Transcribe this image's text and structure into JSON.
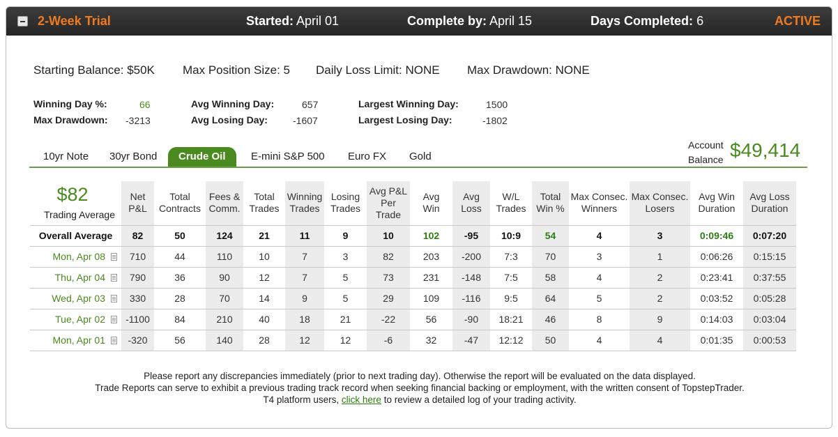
{
  "header": {
    "trial_name": "2-Week Trial",
    "started_label": "Started:",
    "started_value": "April 01",
    "complete_label": "Complete by:",
    "complete_value": "April 15",
    "days_label": "Days Completed:",
    "days_value": "6",
    "status": "ACTIVE",
    "collapse_icon": "minus-icon"
  },
  "rules": {
    "starting_balance": "Starting Balance: $50K",
    "max_position": "Max Position Size: 5",
    "daily_loss": "Daily Loss Limit: NONE",
    "max_drawdown": "Max Drawdown: NONE"
  },
  "kpis": {
    "winning_day_pct_label": "Winning Day %:",
    "winning_day_pct": "66",
    "max_drawdown_label": "Max Drawdown:",
    "max_drawdown": "-3213",
    "avg_winning_day_label": "Avg Winning Day:",
    "avg_winning_day": "657",
    "avg_losing_day_label": "Avg Losing Day:",
    "avg_losing_day": "-1607",
    "largest_winning_day_label": "Largest Winning Day:",
    "largest_winning_day": "1500",
    "largest_losing_day_label": "Largest Losing Day:",
    "largest_losing_day": "-1802"
  },
  "tabs": [
    "10yr Note",
    "30yr Bond",
    "Crude Oil",
    "E-mini S&P 500",
    "Euro FX",
    "Gold"
  ],
  "active_tab": "Crude Oil",
  "account": {
    "label_line1": "Account",
    "label_line2": "Balance",
    "value": "$49,414"
  },
  "trading_average": {
    "value": "$82",
    "label": "Trading Average"
  },
  "table": {
    "headers": [
      [
        "Net",
        "P&L"
      ],
      [
        "Total",
        "Contracts"
      ],
      [
        "Fees &",
        "Comm."
      ],
      [
        "Total",
        "Trades"
      ],
      [
        "Winning",
        "Trades"
      ],
      [
        "Losing",
        "Trades"
      ],
      [
        "Avg P&L",
        "Per",
        "Trade"
      ],
      [
        "Avg",
        "Win"
      ],
      [
        "Avg",
        "Loss"
      ],
      [
        "W/L",
        "Trades"
      ],
      [
        "Total",
        "Win %"
      ],
      [
        "Max Consec.",
        "Winners"
      ],
      [
        "Max Consec.",
        "Losers"
      ],
      [
        "Avg Win",
        "Duration"
      ],
      [
        "Avg Loss",
        "Duration"
      ]
    ],
    "overall": {
      "label": "Overall Average",
      "values": [
        "82",
        "50",
        "124",
        "21",
        "11",
        "9",
        "10",
        "102",
        "-95",
        "10:9",
        "54",
        "4",
        "3",
        "0:09:46",
        "0:07:20"
      ]
    },
    "rows": [
      {
        "date": "Mon, Apr 08",
        "values": [
          "710",
          "44",
          "110",
          "10",
          "7",
          "3",
          "82",
          "203",
          "-200",
          "7:3",
          "70",
          "3",
          "1",
          "0:06:26",
          "0:15:15"
        ]
      },
      {
        "date": "Thu, Apr 04",
        "values": [
          "790",
          "36",
          "90",
          "12",
          "7",
          "5",
          "73",
          "231",
          "-148",
          "7:5",
          "58",
          "4",
          "2",
          "0:23:41",
          "0:37:55"
        ]
      },
      {
        "date": "Wed, Apr 03",
        "values": [
          "330",
          "28",
          "70",
          "14",
          "9",
          "5",
          "29",
          "109",
          "-116",
          "9:5",
          "64",
          "5",
          "2",
          "0:03:52",
          "0:05:28"
        ]
      },
      {
        "date": "Tue, Apr 02",
        "values": [
          "-1100",
          "84",
          "210",
          "40",
          "18",
          "21",
          "-22",
          "56",
          "-90",
          "18:21",
          "46",
          "8",
          "9",
          "0:14:03",
          "0:03:04"
        ]
      },
      {
        "date": "Mon, Apr 01",
        "values": [
          "-320",
          "56",
          "140",
          "28",
          "12",
          "12",
          "-6",
          "32",
          "-47",
          "12:12",
          "50",
          "4",
          "4",
          "0:01:35",
          "0:00:53"
        ]
      }
    ],
    "row_icon": "document-icon"
  },
  "footer": {
    "line1": "Please report any discrepancies immediately (prior to next trading day). Otherwise the report will be evaluated on the data displayed.",
    "line2": "Trade Reports can serve to exhibit a previous trading track record when seeking financial backing or employment, with the written consent of TopstepTrader.",
    "line3_prefix": "T4 platform users,",
    "link": "click here",
    "line3_suffix": "to review a detailed log of your trading activity."
  },
  "colors": {
    "accent_orange": "#f07b1f",
    "accent_green": "#4a8a1e",
    "header_bg": "#2f2f2f"
  }
}
